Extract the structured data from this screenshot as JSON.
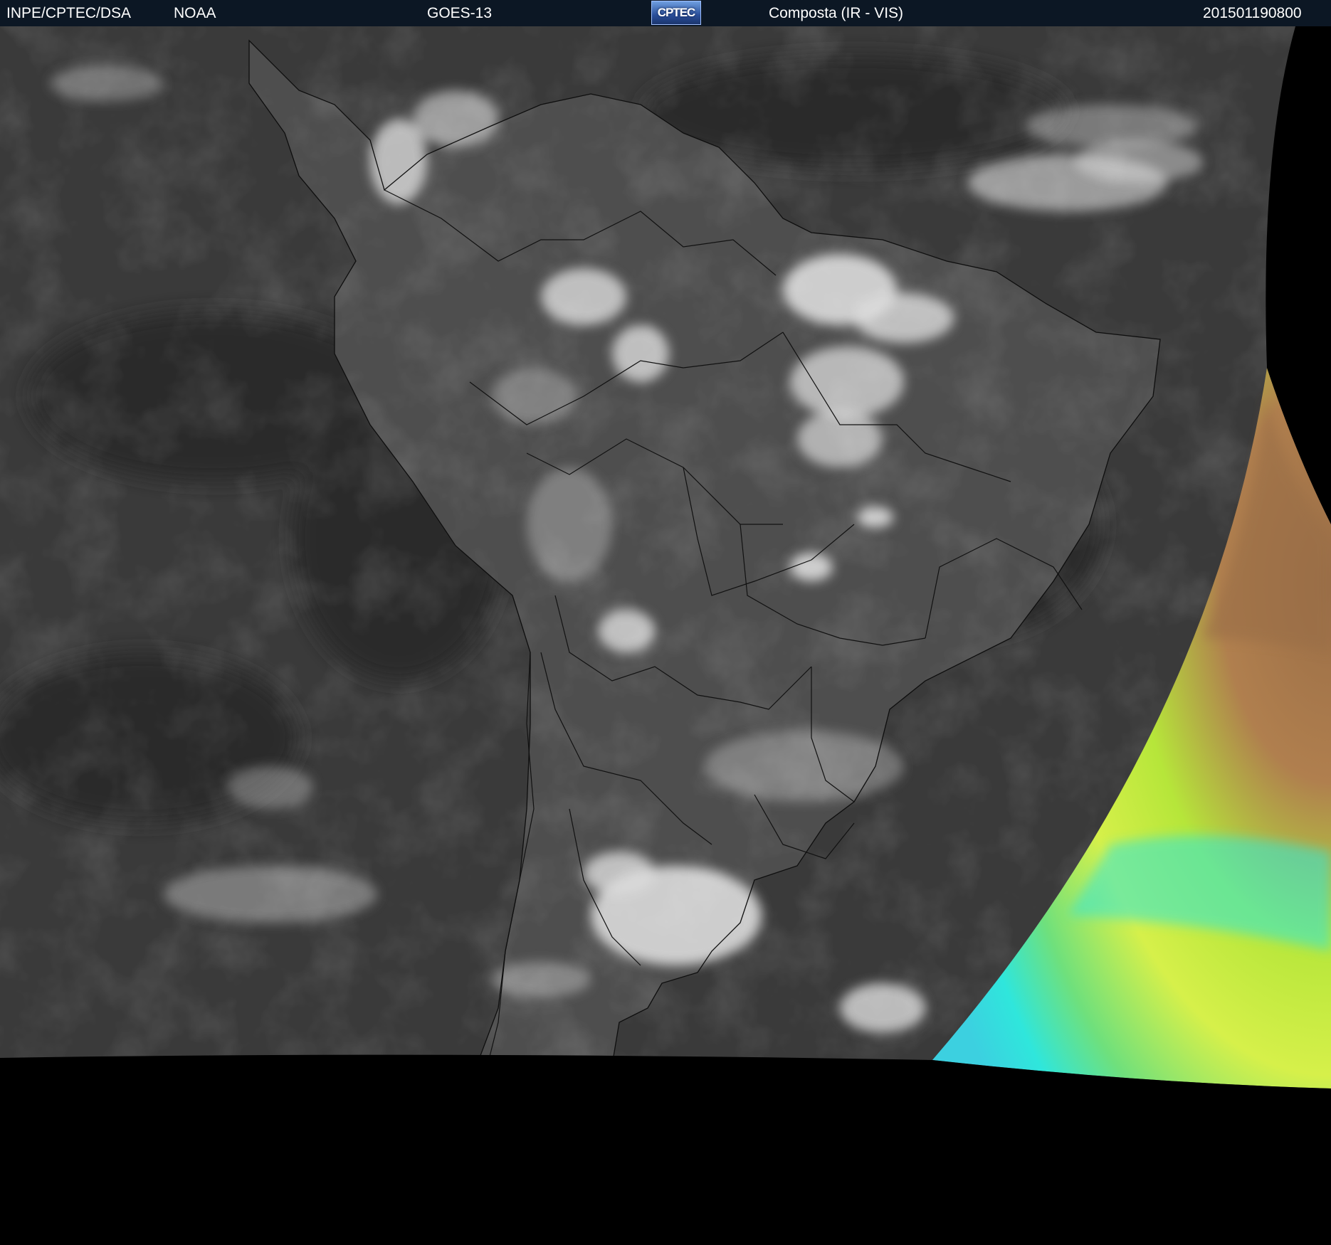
{
  "header": {
    "source": "INPE/CPTEC/DSA",
    "agency": "NOAA",
    "satellite": "GOES-13",
    "logo_text": "CPTEC",
    "product": "Composta (IR - VIS)",
    "timestamp": "201501190800"
  },
  "colors": {
    "header_bg": "#0c1724",
    "ocean_gray": "#3a3a3a",
    "land_gray": "#505050",
    "cloud_white": "#e6e6e6",
    "space_black": "#000000",
    "vis_green": "#b6e63a",
    "vis_orange": "#a8774a",
    "vis_cyan": "#2fe6dc",
    "border_line": "#111111"
  },
  "icons": {
    "logo": "cptec-logo-icon"
  }
}
